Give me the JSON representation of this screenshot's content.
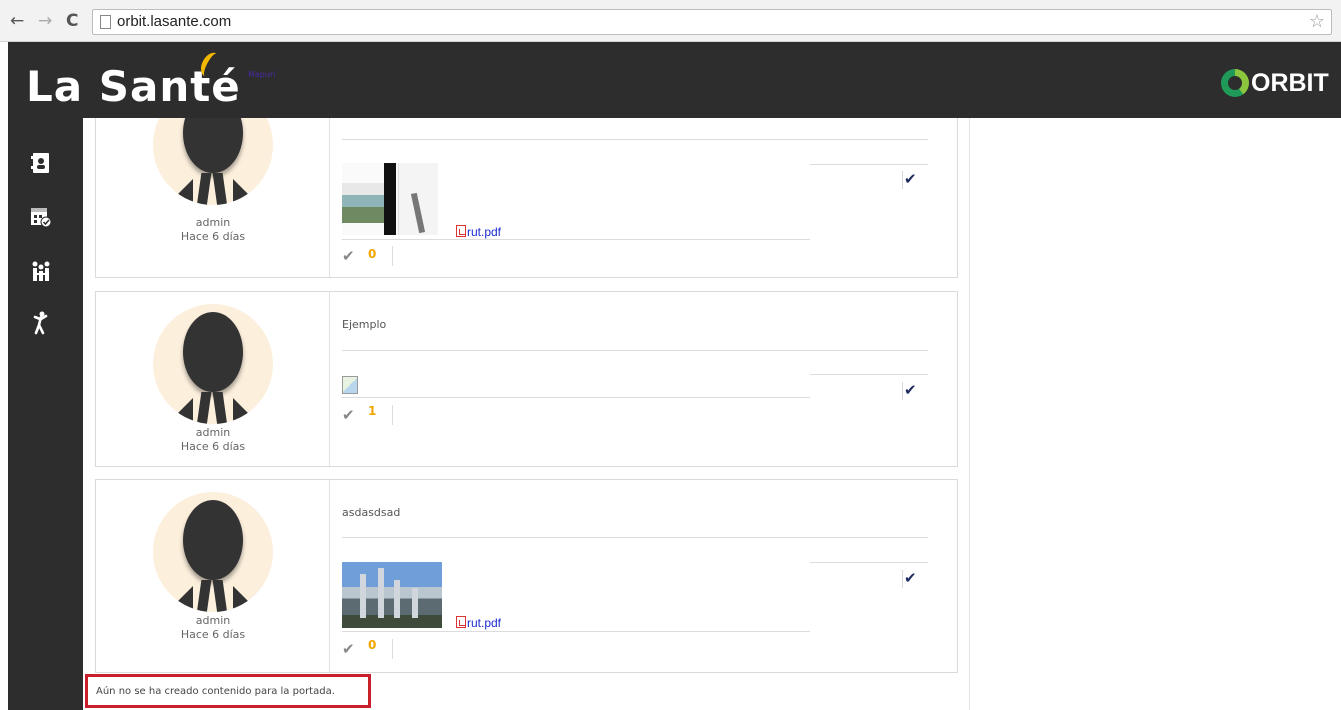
{
  "browser": {
    "url": "orbit.lasante.com",
    "back_glyph": "←",
    "forward_glyph": "→",
    "reload_glyph": "C",
    "star_glyph": "☆"
  },
  "header": {
    "brand": "La Santé",
    "brand_sub": "Mapuri",
    "orbit_logo_text": "ORBIT",
    "colors": {
      "bar": "#2d2d2d",
      "accent": "#f3b800",
      "orbit_green": "#1f9a58"
    }
  },
  "sidebar": {
    "items": [
      {
        "icon": "contacts-book-icon"
      },
      {
        "icon": "calendar-check-icon"
      },
      {
        "icon": "people-meeting-icon"
      },
      {
        "icon": "person-walking-icon"
      }
    ]
  },
  "posts": [
    {
      "title": "",
      "author": "admin",
      "time": "Hace 6 días",
      "attachment": "rut.pdf",
      "likes": "0",
      "check": "✔",
      "like_glyph": "✔"
    },
    {
      "title": "Ejemplo",
      "author": "admin",
      "time": "Hace 6 días",
      "attachment": "",
      "likes": "1",
      "check": "✔",
      "like_glyph": "✔"
    },
    {
      "title": "asdasdsad",
      "author": "admin",
      "time": "Hace 6 días",
      "attachment": "rut.pdf",
      "likes": "0",
      "check": "✔",
      "like_glyph": "✔"
    }
  ],
  "notice": "Aún no se ha creado contenido para la portada.",
  "colors": {
    "notice_border": "#c8202a",
    "check": "#1f2a5e",
    "like_count": "#f0a500",
    "link": "#1a2bd1"
  }
}
